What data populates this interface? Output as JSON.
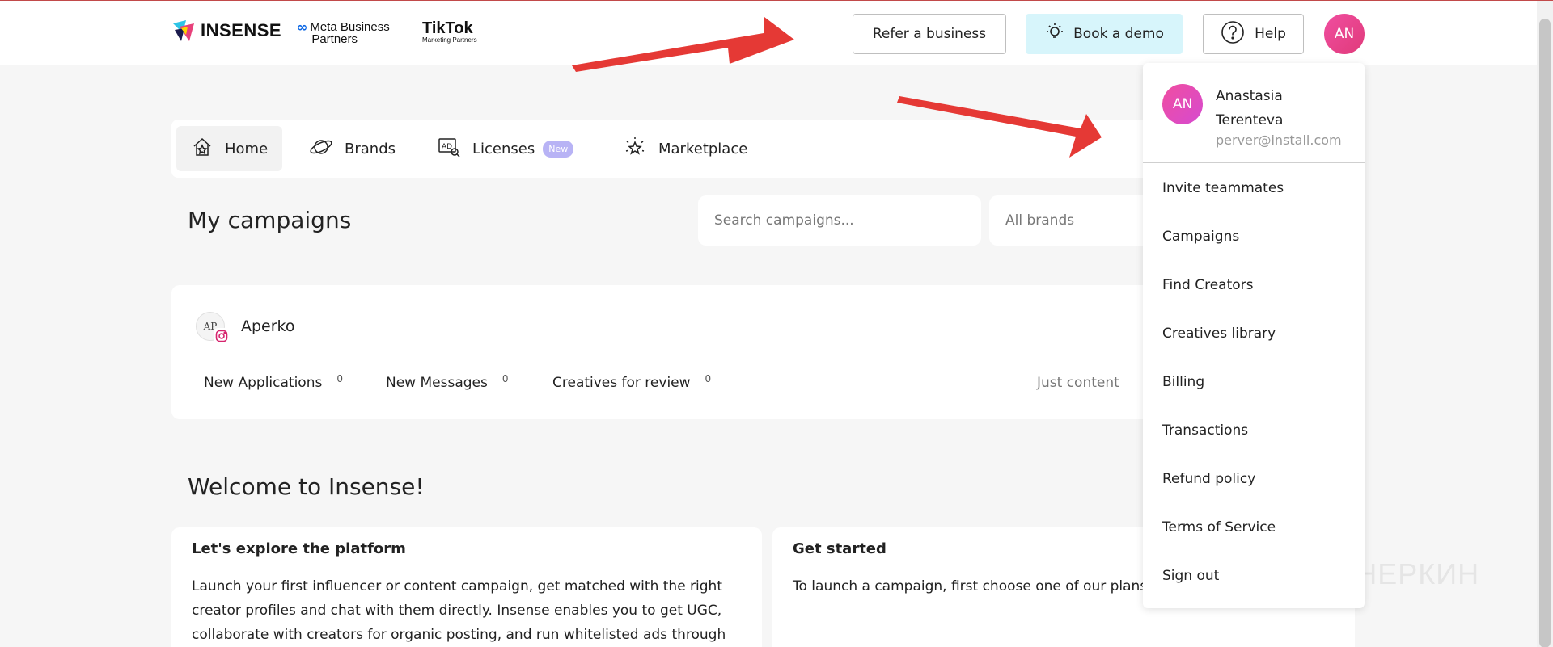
{
  "header": {
    "logo_text": "INSENSE",
    "meta_partner": {
      "line1": "Meta Business",
      "line2": "Partners"
    },
    "tiktok_partner": {
      "name": "TikTok",
      "sub": "Marketing Partners"
    },
    "refer_label": "Refer a business",
    "demo_label": "Book a demo",
    "help_label": "Help",
    "avatar_initials": "AN"
  },
  "nav": {
    "items": [
      {
        "label": "Home",
        "active": true
      },
      {
        "label": "Brands"
      },
      {
        "label": "Licenses",
        "badge": "New"
      },
      {
        "label": "Marketplace"
      }
    ]
  },
  "campaigns": {
    "title": "My campaigns",
    "search_placeholder": "Search campaigns...",
    "brand_filter": "All brands"
  },
  "campaign_card": {
    "brand_logo_text": "AP",
    "brand_name": "Aperko",
    "stats": [
      {
        "label": "New Applications",
        "count": "0"
      },
      {
        "label": "New Messages",
        "count": "0"
      },
      {
        "label": "Creatives for review",
        "count": "0"
      }
    ],
    "type_label": "Just content"
  },
  "welcome": {
    "title": "Welcome to Insense!",
    "explore": {
      "heading": "Let's explore the platform",
      "text": "Launch your first influencer or content campaign, get matched with the right creator profiles and chat with them directly. Insense enables you to get UGC, collaborate with creators for organic posting, and run whitelisted ads through"
    },
    "get_started": {
      "heading": "Get started",
      "text": "To launch a campaign, first choose one of our plans"
    }
  },
  "user_menu": {
    "initials": "AN",
    "name": "Anastasia Terenteva",
    "email": "perver@install.com",
    "items": [
      "Invite teammates",
      "Campaigns",
      "Find Creators",
      "Creatives library",
      "Billing",
      "Transactions",
      "Refund policy",
      "Terms of Service",
      "Sign out"
    ]
  },
  "watermark": {
    "text": "ПАРТНЕРКИН"
  },
  "colors": {
    "accent_pink": "#f04ea0",
    "demo_bg": "#d7f5fb",
    "badge_new": "#b8b3f5",
    "annotation_arrow": "#e53935"
  }
}
